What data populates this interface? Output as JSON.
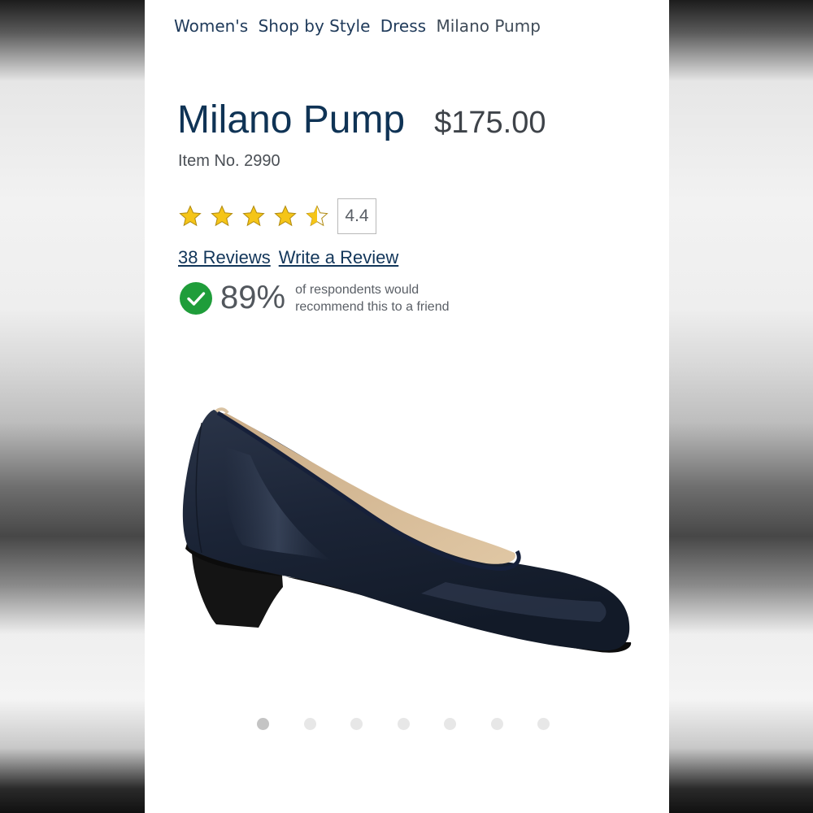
{
  "breadcrumb": {
    "items": [
      "Women's",
      "Shop by Style",
      "Dress"
    ],
    "current": "Milano Pump"
  },
  "product": {
    "title": "Milano Pump",
    "price": "$175.00",
    "item_no": "Item No. 2990"
  },
  "rating": {
    "value": "4.4",
    "stars_filled": 4.4,
    "stars_total": 5,
    "star_color": "#f5c518"
  },
  "reviews": {
    "count_link": "38 Reviews",
    "write_link": "Write a Review"
  },
  "recommend": {
    "percent": "89%",
    "line1": "of respondents would",
    "line2": "recommend this to a friend",
    "check_color": "#1f9d3a"
  },
  "image": {
    "icon": "shoe-image"
  },
  "carousel": {
    "total": 7,
    "active": 1
  }
}
